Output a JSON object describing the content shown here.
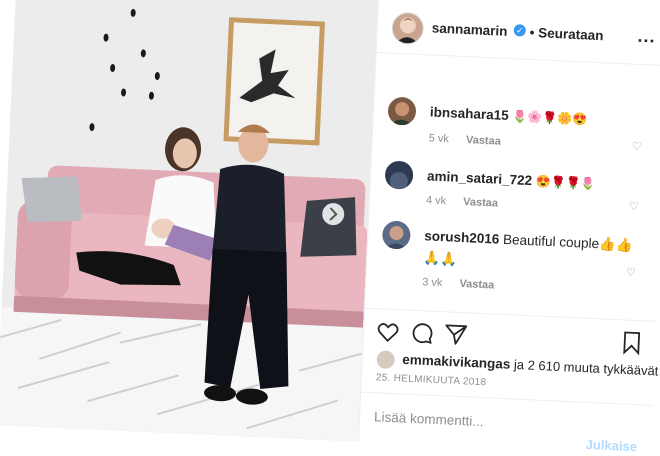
{
  "post_header": {
    "username": "sannamarin",
    "separator": "•",
    "follow_label": "Seurataan",
    "more_label": "..."
  },
  "comments": [
    {
      "username": "ibnsahara15",
      "text": "🌷🌸🌹🌼😍",
      "time": "5 vk",
      "reply_label": "Vastaa",
      "avatar_color": "#7a5a43"
    },
    {
      "username": "amin_satari_722",
      "text": "😍🌹🌹🌷",
      "time": "4 vk",
      "reply_label": "Vastaa",
      "avatar_color": "#3d4a5e"
    },
    {
      "username": "sorush2016",
      "text": "Beautiful couple👍👍",
      "text2": "🙏🙏",
      "time": "3 vk",
      "reply_label": "Vastaa",
      "avatar_color": "#5b6a86"
    }
  ],
  "likes": {
    "liker": "emmakivikangas",
    "rest": "ja 2 610 muuta",
    "suffix": "tykkäävät"
  },
  "date": "25. HELMIKUUTA 2018",
  "composer": {
    "placeholder": "Lisää kommentti...",
    "post_label": "Julkaise"
  },
  "icons": {
    "like": "heart-icon",
    "comment": "comment-icon",
    "share": "paper-plane-icon",
    "save": "bookmark-icon",
    "next": "chevron-right-icon",
    "verified": "verified-badge-icon"
  },
  "colors": {
    "verified": "#3897f0",
    "meta_text": "#8e8e8e",
    "sofa": "#e2aab4"
  }
}
